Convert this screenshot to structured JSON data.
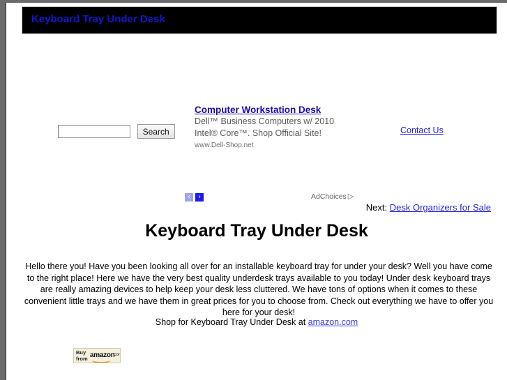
{
  "header": {
    "title": "Keyboard Tray Under Desk"
  },
  "search": {
    "value": "",
    "placeholder": "",
    "button_label": "Search"
  },
  "ad": {
    "title": "Computer Workstation Desk",
    "line1": "Dell™ Business Computers w/ 2010",
    "line2": "Intel® Core™. Shop Official Site!",
    "url": "www.Dell-Shop.net",
    "prev_arrow": "‹",
    "next_arrow": "›",
    "adchoices_label": "AdChoices",
    "adchoices_glyph": "▷"
  },
  "contact": {
    "label": "Contact Us"
  },
  "nav": {
    "next_prefix": "Next:",
    "next_label": "Desk Organizers for Sale"
  },
  "main": {
    "heading": "Keyboard Tray Under Desk",
    "paragraph": "Hello there you! Have you been looking all over for an installable keyboard tray for under your desk? Well you have come to the right place! Here we have the very best quality underdesk trays available to you today! Under desk keyboard trays are really amazing devices to help keep your desk less cluttered. We have tons of options when it comes to these convenient little trays and we have them in great prices for you to choose from. Check out everything we have to offer you here for your desk!",
    "shop_prefix": "Shop for Keyboard Tray Under Desk at",
    "shop_link": "amazon.com"
  },
  "badge": {
    "buy": "Buy",
    "from": "from",
    "wordmark": "amazon",
    "dotcom": "com"
  },
  "colors": {
    "header_bg": "#000000",
    "header_text": "#1414cf",
    "link": "#2222dd",
    "ad_link": "#1a0dab",
    "amazon_orange": "#ef8e20"
  }
}
